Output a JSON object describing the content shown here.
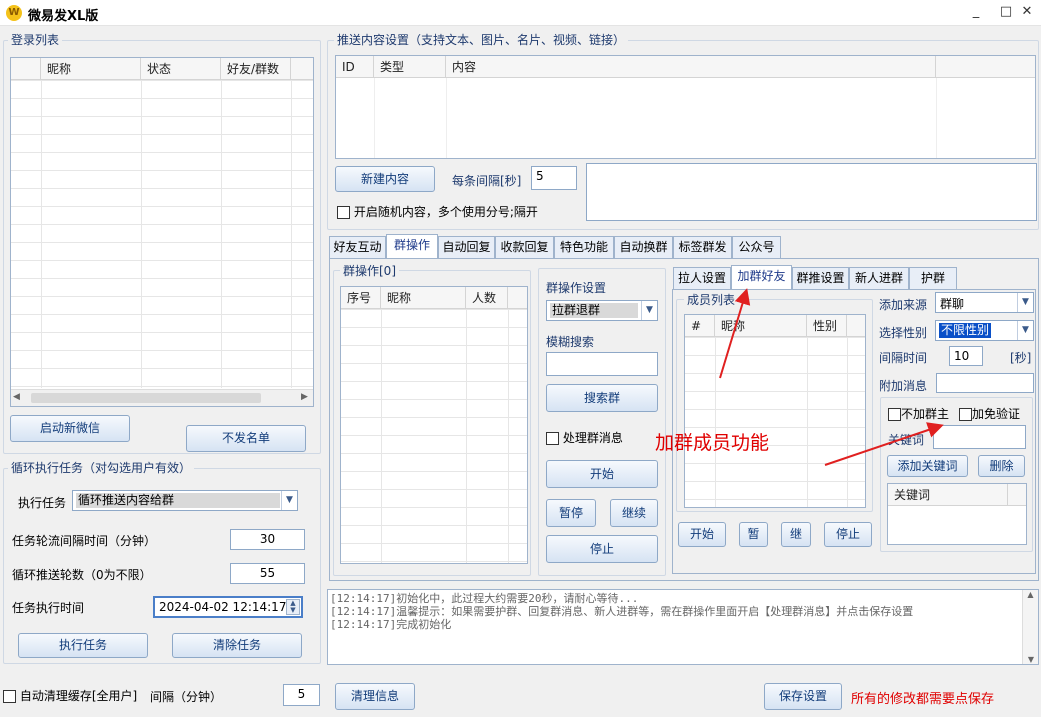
{
  "window": {
    "title": "微易发XL版",
    "logo": "W",
    "controls": [
      "_",
      "□",
      "✕"
    ]
  },
  "login": {
    "legend": "登录列表",
    "columns": [
      "昵称",
      "状态",
      "好友/群数"
    ],
    "start_btn": "启动新微信",
    "blacklist_btn": "不发名单"
  },
  "loop": {
    "legend": "循环执行任务（对勾选用户有效）",
    "task_label": "执行任务",
    "task_value": "循环推送内容给群",
    "interval_label": "任务轮流间隔时间（分钟）",
    "interval_value": "30",
    "rounds_label": "循环推送轮数（0为不限）",
    "rounds_value": "55",
    "time_label": "任务执行时间",
    "time_value": "2024-04-02 12:14:17",
    "exec_btn": "执行任务",
    "clear_btn": "清除任务"
  },
  "footer_left": {
    "cache_label": "自动清理缓存[全用户]",
    "gap_label": "间隔（分钟）",
    "gap_value": "5"
  },
  "push": {
    "legend": "推送内容设置（支持文本、图片、名片、视频、链接）",
    "columns": [
      "ID",
      "类型",
      "内容"
    ],
    "new_btn": "新建内容",
    "interval_label": "每条间隔[秒]",
    "interval_value": "5",
    "random_label": "开启随机内容，多个使用分号;隔开"
  },
  "tabs": [
    "好友互动",
    "群操作",
    "自动回复",
    "收款回复",
    "特色功能",
    "自动换群",
    "标签群发",
    "公众号"
  ],
  "group_op": {
    "legend": "群操作[0]",
    "columns": [
      "序号",
      "昵称",
      "人数"
    ],
    "settings_label": "群操作设置",
    "op_value": "拉群退群",
    "fuzzy_label": "模糊搜索",
    "search_btn": "搜索群",
    "process_label": "处理群消息",
    "start_btn": "开始",
    "pause_btn": "暂停",
    "continue_btn": "继续",
    "stop_btn": "停止"
  },
  "subtabs": [
    "拉人设置",
    "加群好友",
    "群推设置",
    "新人进群",
    "护群"
  ],
  "add_friend": {
    "legend": "成员列表",
    "columns": [
      "#",
      "昵称",
      "性别"
    ],
    "source_label": "添加来源",
    "source_value": "群聊",
    "gender_label": "选择性别",
    "gender_value": "不限性别",
    "interval_label": "间隔时间",
    "interval_value": "10",
    "sec_label": "[秒]",
    "extra_label": "附加消息",
    "no_owner_label": "不加群主",
    "no_verify_label": "加免验证",
    "keyword_label": "关键词",
    "add_kw_btn": "添加关键词",
    "del_btn": "删除",
    "kw_column": "关键词",
    "start_btn": "开始",
    "pause_btn": "暂",
    "continue_btn": "继",
    "stop_btn": "停止"
  },
  "annotation": "加群成员功能",
  "log": [
    "[12:14:17]初始化中，此过程大约需要20秒，请耐心等待...",
    "[12:14:17]温馨提示：如果需要护群、回复群消息、新人进群等，需在群操作里面开启【处理群消息】并点击保存设置",
    "[12:14:17]完成初始化"
  ],
  "bottom": {
    "clear_btn": "清理信息",
    "save_btn": "保存设置",
    "save_hint": "所有的修改都需要点保存"
  },
  "colors": {
    "accent": "#1e3a6e",
    "annotation": "#e02020"
  }
}
